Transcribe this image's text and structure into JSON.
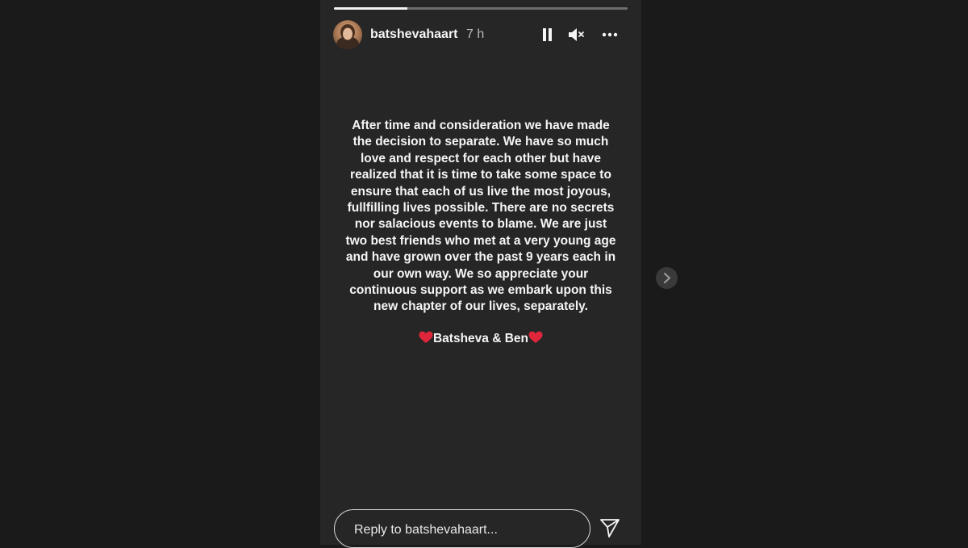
{
  "story": {
    "progress_fraction": 0.25,
    "username": "batshevahaart",
    "timestamp": "7 h",
    "message_lines": [
      "After time and consideration we have made",
      "the decision to separate. We have so much",
      "love and respect for each other but have",
      "realized that it is time to take some space to",
      "ensure that each of us live the most joyous,",
      "fullfilling lives possible. There are no secrets",
      "nor salacious events to blame. We are just",
      "two best friends who met at a very young age",
      "and have grown over the past 9 years each in",
      "our own way. We so appreciate your",
      "continuous support as we embark upon this",
      "new chapter of our lives, separately."
    ],
    "signature": "Batsheva & Ben",
    "reply_placeholder": "Reply to batshevahaart..."
  },
  "icons": {
    "pause": "pause-icon",
    "mute": "speaker-muted-icon",
    "more": "more-dots-icon",
    "send": "paper-plane-icon",
    "next": "chevron-right-icon",
    "heart": "red-heart-icon"
  },
  "colors": {
    "page_background": "#1a1a1a",
    "story_background": "#262626",
    "heart": "#e0263a"
  }
}
